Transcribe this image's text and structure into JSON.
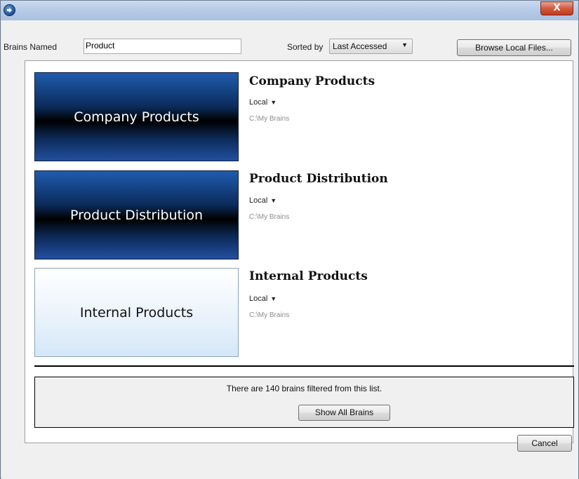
{
  "window": {
    "close_label": "X"
  },
  "filter": {
    "label": "Brains Named",
    "value": "Product",
    "sort_label": "Sorted by",
    "sort_value": "Last Accessed",
    "browse_label": "Browse Local Files..."
  },
  "brains": [
    {
      "title": "Company Products",
      "thumb_text": "Company Products",
      "location": "Local",
      "path": "C:\\My Brains",
      "style": "dark"
    },
    {
      "title": "Product Distribution",
      "thumb_text": "Product Distribution",
      "location": "Local",
      "path": "C:\\My Brains",
      "style": "dark"
    },
    {
      "title": "Internal Products",
      "thumb_text": "Internal Products",
      "location": "Local",
      "path": "C:\\My Brains",
      "style": "light"
    }
  ],
  "footer": {
    "filtered_message": "There are 140 brains filtered from this list.",
    "show_all_label": "Show All Brains",
    "cancel_label": "Cancel"
  },
  "icons": {
    "app": "app-logo-icon",
    "close": "close-icon",
    "dropdown": "chevron-down-icon"
  }
}
